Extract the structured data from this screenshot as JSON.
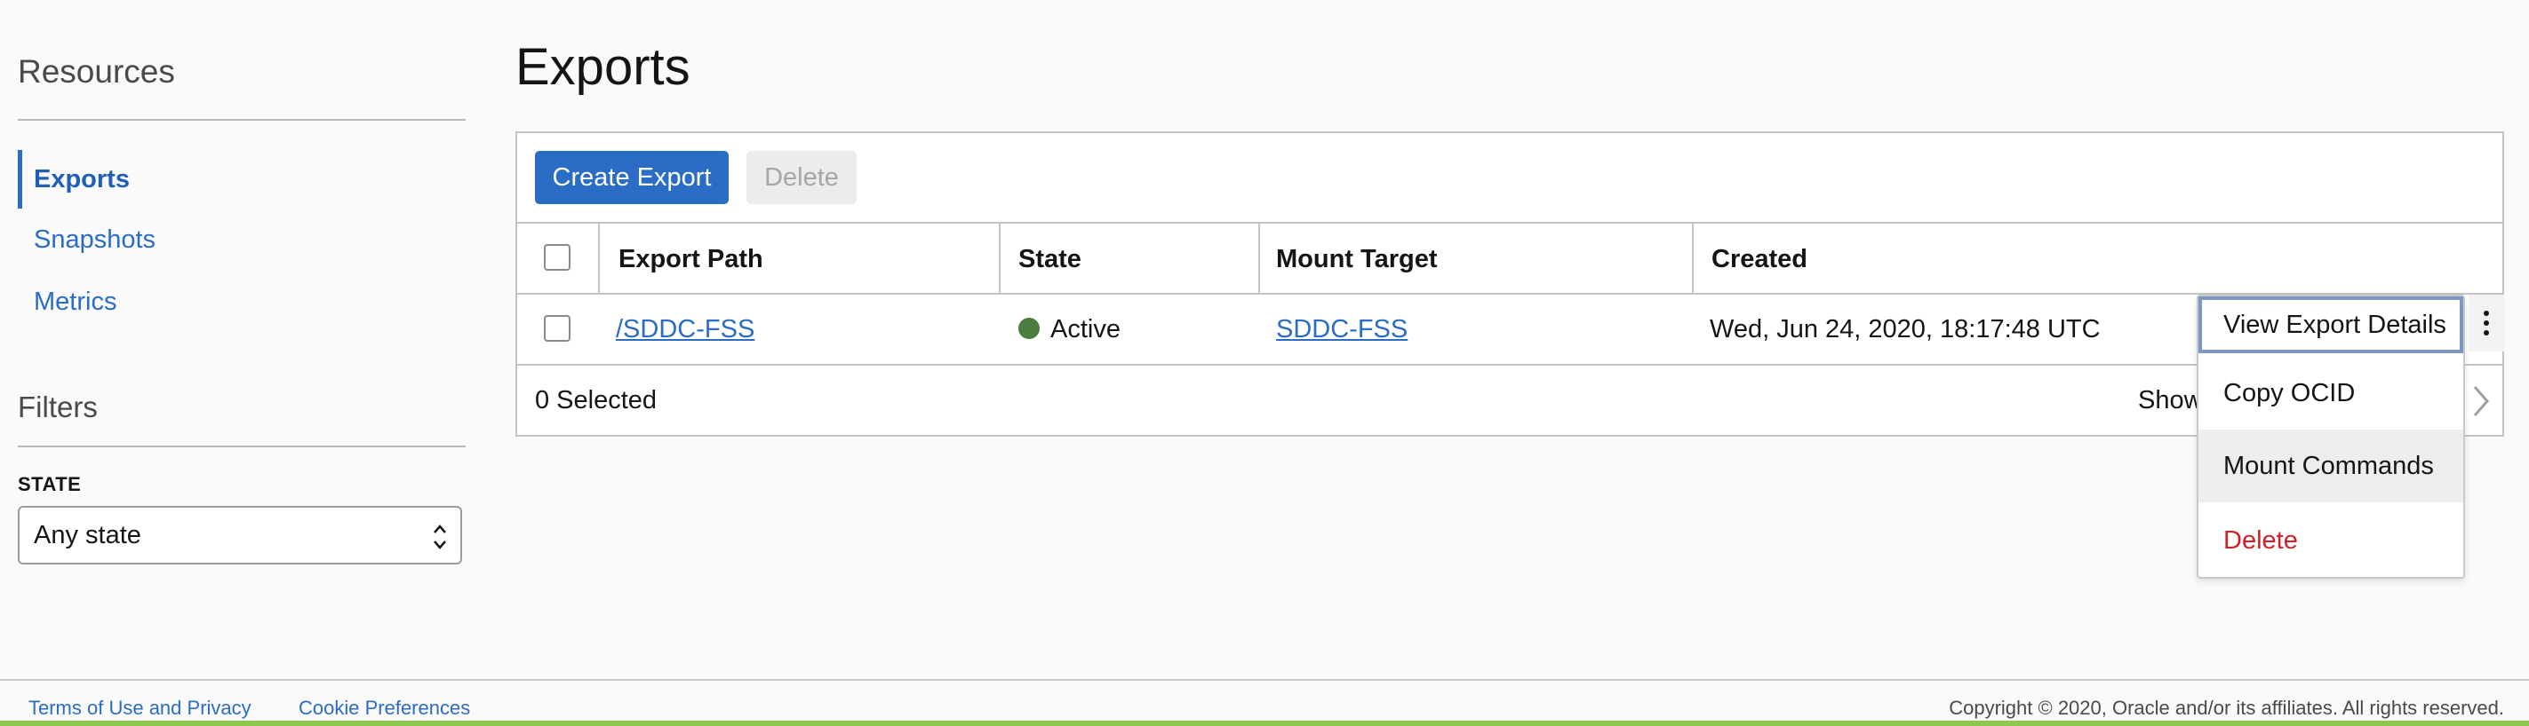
{
  "sidebar": {
    "resources_heading": "Resources",
    "items": [
      {
        "label": "Exports",
        "active": true
      },
      {
        "label": "Snapshots",
        "active": false
      },
      {
        "label": "Metrics",
        "active": false
      }
    ],
    "filters_heading": "Filters",
    "state_filter": {
      "label": "STATE",
      "value": "Any state"
    }
  },
  "main": {
    "title": "Exports",
    "toolbar": {
      "create_label": "Create Export",
      "delete_label": "Delete"
    },
    "table": {
      "columns": [
        "Export Path",
        "State",
        "Mount Target",
        "Created"
      ],
      "rows": [
        {
          "export_path": "/SDDC-FSS",
          "state": "Active",
          "mount_target": "SDDC-FSS",
          "created": "Wed, Jun 24, 2020, 18:17:48 UTC"
        }
      ],
      "selected_text": "0 Selected",
      "showing_text": "Show"
    },
    "row_menu": {
      "items": [
        "View Export Details",
        "Copy OCID",
        "Mount Commands",
        "Delete"
      ]
    }
  },
  "footer": {
    "terms_label": "Terms of Use and Privacy",
    "cookie_label": "Cookie Preferences",
    "copyright": "Copyright © 2020, Oracle and/or its affiliates. All rights reserved."
  },
  "colors": {
    "accent": "#2b6cc4",
    "status_active": "#4b7d3e",
    "danger": "#d0202a"
  },
  "icons": [
    "chevron-right-icon",
    "more-actions-icon",
    "select-arrows-icon",
    "status-active-icon"
  ]
}
